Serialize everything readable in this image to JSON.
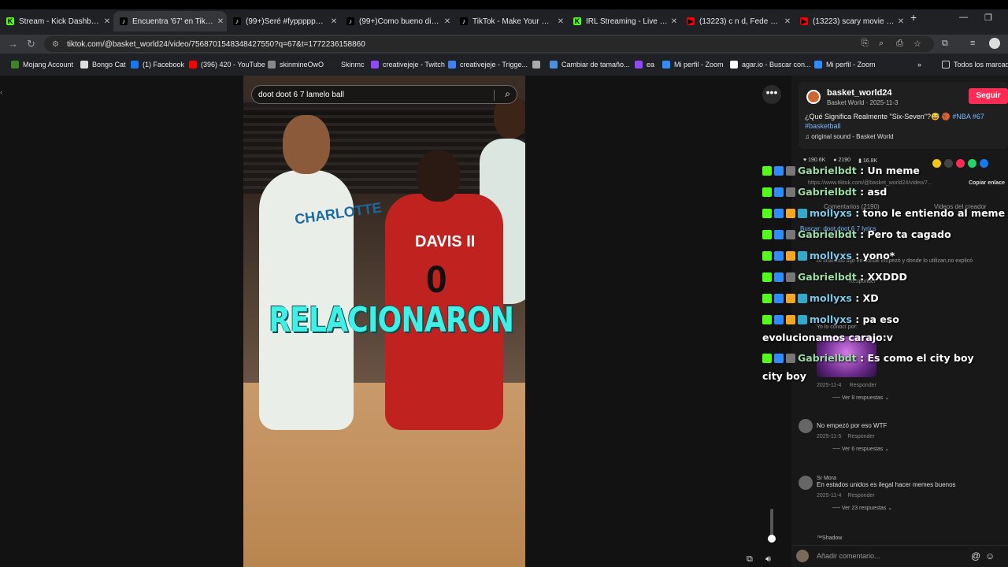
{
  "browser": {
    "tabs": [
      {
        "title": "Stream - Kick Dashboard",
        "fav_color": "#53fc18",
        "fav_char": "K"
      },
      {
        "title": "Encuentra '67' en TikTok",
        "fav_color": "#000000",
        "fav_char": "♪",
        "active": true
      },
      {
        "title": "(99+)Seré #fypppppppp",
        "fav_color": "#000000",
        "fav_char": "♪"
      },
      {
        "title": "(99+)Como bueno dice de",
        "fav_color": "#000000",
        "fav_char": "♪"
      },
      {
        "title": "TikTok - Make Your Day",
        "fav_color": "#000000",
        "fav_char": "♪"
      },
      {
        "title": "IRL Streaming - Live Strea",
        "fav_color": "#53fc18",
        "fav_char": "K"
      },
      {
        "title": "(13223) c n d, Fede Guelm",
        "fav_color": "#ff0000",
        "fav_char": "▶"
      },
      {
        "title": "(13223) scary movie 7 tra",
        "fav_color": "#ff0000",
        "fav_char": "▶"
      }
    ],
    "new_tab": "+",
    "minimize": "—",
    "restore": "❐",
    "url": "tiktok.com/@basket_world24/video/7568701548348427550?q=67&t=1772236158860",
    "bookmarks": [
      {
        "label": "Mojang Account",
        "color": "#3c8527"
      },
      {
        "label": "Bongo Cat",
        "color": "#dddddd"
      },
      {
        "label": "(1) Facebook",
        "color": "#1877f2"
      },
      {
        "label": "(396) 420 - YouTube",
        "color": "#ff0000"
      },
      {
        "label": "skinmineOwO",
        "color": "#888888"
      },
      {
        "label": "Skinmc",
        "color": "#222222"
      },
      {
        "label": "creativejeje - Twitch",
        "color": "#9146ff"
      },
      {
        "label": "creativejeje - Trigge...",
        "color": "#3b82f6"
      },
      {
        "label": "",
        "color": "#aaaaaa"
      },
      {
        "label": "Cambiar de tamaño...",
        "color": "#4a90e2"
      },
      {
        "label": "ea",
        "color": "#9146ff"
      },
      {
        "label": "Mi perfil - Zoom",
        "color": "#2d8cff"
      },
      {
        "label": "agar.io - Buscar con...",
        "color": "#ffffff"
      },
      {
        "label": "Mi perfil - Zoom",
        "color": "#2d8cff"
      }
    ],
    "bookmarks_overflow": "»",
    "all_bookmarks": "Todos los marcadores"
  },
  "video": {
    "search_text": "doot doot 6 7 lamelo ball",
    "caption": "RELACIONARON",
    "jersey_left": "CHARLOTTE",
    "jersey_name": "DAVIS II",
    "jersey_number": "0"
  },
  "creator": {
    "username": "basket_world24",
    "subtitle": "Basket World · 2025-11-3",
    "follow": "Seguir",
    "description": "¿Qué Significa Realmente \"Six-Seven\"?😅 🏀",
    "tags": "#NBA #67 #basketball",
    "sound": "original sound - Basket World"
  },
  "stats": {
    "likes": "190.6K",
    "comments": "2190",
    "saves": "16.8K"
  },
  "link": {
    "url": "https://www.tiktok.com/@basket_world24/video/7...",
    "copy": "Copiar enlace"
  },
  "faded": {
    "comments_tab": "Comentarios (2190)",
    "creator_videos": "Videos del creador",
    "search_lyrics": "Buscar: doot doot 6 7 lyrics",
    "comment1": "Al final solo dijo en donde empezó y donde lo utilizan,no explicó",
    "reply1": "Responder",
    "comment2": "Yo lo conocí por:"
  },
  "chat": [
    {
      "user": "Gabrielbdt",
      "text": ": Un meme",
      "kind": "u1",
      "sub": false
    },
    {
      "user": "Gabrielbdt",
      "text": ": asd",
      "kind": "u1",
      "sub": false
    },
    {
      "user": "mollyxs",
      "text": ": tono le entiendo al meme",
      "kind": "u2",
      "sub": true
    },
    {
      "user": "Gabrielbdt",
      "text": ": Pero ta cagado",
      "kind": "u1",
      "sub": false
    },
    {
      "user": "mollyxs",
      "text": ": yono*",
      "kind": "u2",
      "sub": true
    },
    {
      "user": "Gabrielbdt",
      "text": ": XXDDD",
      "kind": "u1",
      "sub": false
    },
    {
      "user": "mollyxs",
      "text": ": XD",
      "kind": "u2",
      "sub": true
    },
    {
      "user": "mollyxs",
      "text": ": pa eso evolucionamos carajo:v",
      "kind": "u2",
      "sub": true
    },
    {
      "user": "Gabrielbdt",
      "text": ": Es como el city boy city boy",
      "kind": "u1",
      "sub": false
    }
  ],
  "comments": [
    {
      "date": "2025-11-4",
      "reply": "Responder",
      "more": "Ver 8 respuestas"
    },
    {
      "author": "",
      "text": "No empezó por eso WTF",
      "date": "2025-11-5",
      "reply": "Responder",
      "more": "Ver 6 respuestas"
    },
    {
      "author": "Sr Mora",
      "text": "En estados unidos es ilegal hacer memes buenos",
      "date": "2025-11-4",
      "reply": "Responder",
      "more": "Ver 23 respuestas"
    },
    {
      "author": "™Shadow"
    }
  ],
  "comment_input": {
    "placeholder": "Añadir comentario..."
  }
}
